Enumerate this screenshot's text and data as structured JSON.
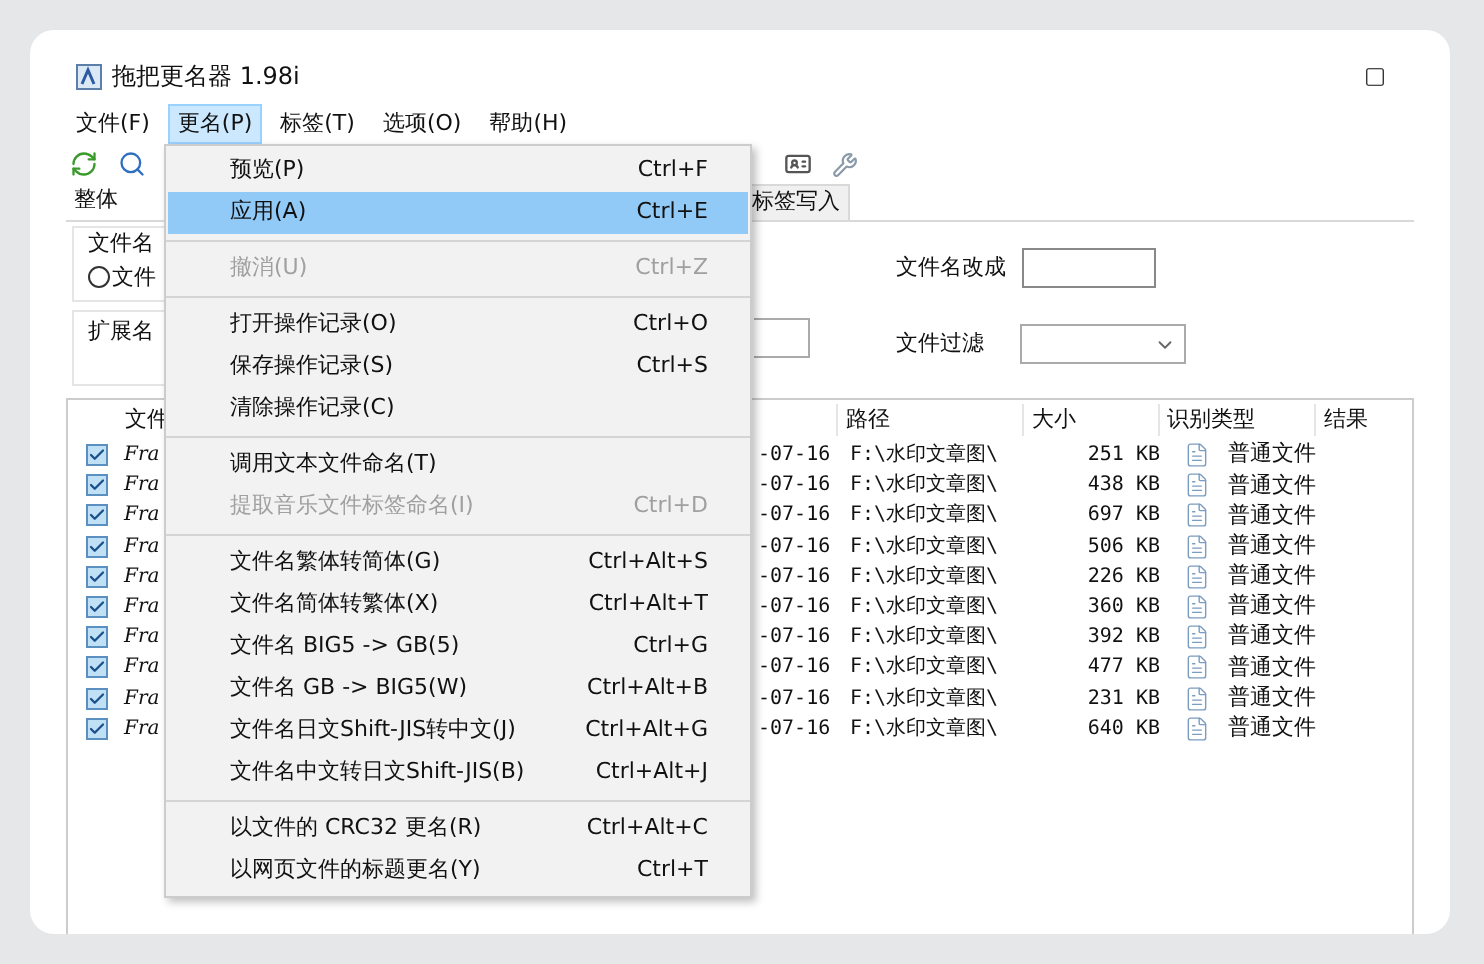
{
  "window": {
    "title": "拖把更名器 1.98i"
  },
  "menu_bar": [
    {
      "label": "文件(F)",
      "selected": false
    },
    {
      "label": "更名(P)",
      "selected": true
    },
    {
      "label": "标签(T)",
      "selected": false
    },
    {
      "label": "选项(O)",
      "selected": false
    },
    {
      "label": "帮助(H)",
      "selected": false
    }
  ],
  "tabs": [
    {
      "label": "整体",
      "selected": true
    },
    {
      "label": "标签写入",
      "selected": false
    }
  ],
  "form": {
    "filename_group": "文件名",
    "filename_radio": {
      "label": "文件",
      "selected": false
    },
    "ext_group": "扩展名",
    "rename_to": {
      "label": "文件名改成"
    },
    "filter": {
      "label": "文件过滤"
    }
  },
  "table": {
    "columns": [
      "文件",
      "路径",
      "大小",
      "识别类型",
      "结果"
    ],
    "rows": [
      {
        "name": "Fra",
        "checked": true,
        "date": "-07-16",
        "path": "F:\\水印文章图\\",
        "size": "251 KB",
        "type": "普通文件"
      },
      {
        "name": "Fra",
        "checked": true,
        "date": "-07-16",
        "path": "F:\\水印文章图\\",
        "size": "438 KB",
        "type": "普通文件"
      },
      {
        "name": "Fra",
        "checked": true,
        "date": "-07-16",
        "path": "F:\\水印文章图\\",
        "size": "697 KB",
        "type": "普通文件"
      },
      {
        "name": "Fra",
        "checked": true,
        "date": "-07-16",
        "path": "F:\\水印文章图\\",
        "size": "506 KB",
        "type": "普通文件"
      },
      {
        "name": "Fra",
        "checked": true,
        "date": "-07-16",
        "path": "F:\\水印文章图\\",
        "size": "226 KB",
        "type": "普通文件"
      },
      {
        "name": "Fra",
        "checked": true,
        "date": "-07-16",
        "path": "F:\\水印文章图\\",
        "size": "360 KB",
        "type": "普通文件"
      },
      {
        "name": "Fra",
        "checked": true,
        "date": "-07-16",
        "path": "F:\\水印文章图\\",
        "size": "392 KB",
        "type": "普通文件"
      },
      {
        "name": "Fra",
        "checked": true,
        "date": "-07-16",
        "path": "F:\\水印文章图\\",
        "size": "477 KB",
        "type": "普通文件"
      },
      {
        "name": "Fra",
        "checked": true,
        "date": "-07-16",
        "path": "F:\\水印文章图\\",
        "size": "231 KB",
        "type": "普通文件"
      },
      {
        "name": "Fra",
        "checked": true,
        "date": "-07-16",
        "path": "F:\\水印文章图\\",
        "size": "640 KB",
        "type": "普通文件"
      }
    ]
  },
  "dropdown_menu": [
    {
      "kind": "item",
      "label": "预览(P)",
      "shortcut": "Ctrl+F",
      "disabled": false,
      "selected": false
    },
    {
      "kind": "item",
      "label": "应用(A)",
      "shortcut": "Ctrl+E",
      "disabled": false,
      "selected": true
    },
    {
      "kind": "separator"
    },
    {
      "kind": "item",
      "label": "撤消(U)",
      "shortcut": "Ctrl+Z",
      "disabled": true,
      "selected": false
    },
    {
      "kind": "separator"
    },
    {
      "kind": "item",
      "label": "打开操作记录(O)",
      "shortcut": "Ctrl+O",
      "disabled": false,
      "selected": false
    },
    {
      "kind": "item",
      "label": "保存操作记录(S)",
      "shortcut": "Ctrl+S",
      "disabled": false,
      "selected": false
    },
    {
      "kind": "item",
      "label": "清除操作记录(C)",
      "disabled": false,
      "selected": false
    },
    {
      "kind": "separator"
    },
    {
      "kind": "item",
      "label": "调用文本文件命名(T)",
      "disabled": false,
      "selected": false
    },
    {
      "kind": "item",
      "label": "提取音乐文件标签命名(I)",
      "shortcut": "Ctrl+D",
      "disabled": true,
      "selected": false
    },
    {
      "kind": "separator"
    },
    {
      "kind": "item",
      "label": "文件名繁体转简体(G)",
      "shortcut": "Ctrl+Alt+S",
      "disabled": false,
      "selected": false
    },
    {
      "kind": "item",
      "label": "文件名简体转繁体(X)",
      "shortcut": "Ctrl+Alt+T",
      "disabled": false,
      "selected": false
    },
    {
      "kind": "item",
      "label": "文件名 BIG5 -> GB(5)",
      "shortcut": "Ctrl+G",
      "disabled": false,
      "selected": false
    },
    {
      "kind": "item",
      "label": "文件名 GB -> BIG5(W)",
      "shortcut": "Ctrl+Alt+B",
      "disabled": false,
      "selected": false
    },
    {
      "kind": "item",
      "label": "文件名日文Shift-JIS转中文(J)",
      "shortcut": "Ctrl+Alt+G",
      "disabled": false,
      "selected": false
    },
    {
      "kind": "item",
      "label": "文件名中文转日文Shift-JIS(B)",
      "shortcut": "Ctrl+Alt+J",
      "disabled": false,
      "selected": false
    },
    {
      "kind": "separator"
    },
    {
      "kind": "item",
      "label": "以文件的 CRC32 更名(R)",
      "shortcut": "Ctrl+Alt+C",
      "disabled": false,
      "selected": false
    },
    {
      "kind": "item",
      "label": "以网页文件的标题更名(Y)",
      "shortcut": "Ctrl+T",
      "disabled": false,
      "selected": false
    }
  ]
}
